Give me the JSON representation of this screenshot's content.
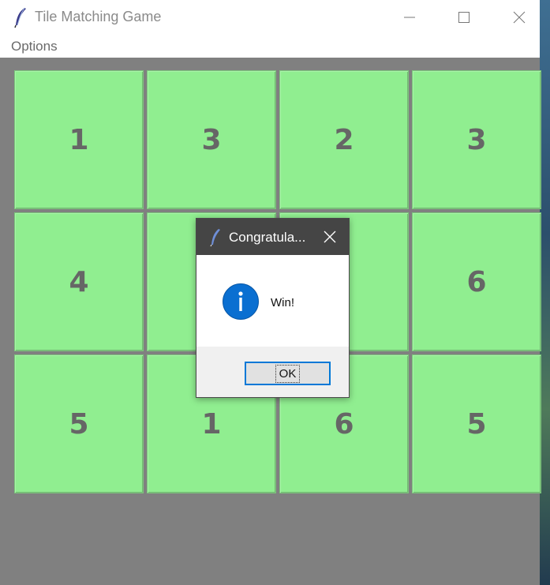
{
  "window": {
    "title": "Tile Matching Game",
    "icon": "feather-icon"
  },
  "menu": {
    "items": [
      {
        "label": "Options"
      }
    ]
  },
  "board": {
    "tile_color": "#90ee90",
    "rows": [
      [
        "1",
        "3",
        "2",
        "3"
      ],
      [
        "4",
        "",
        "",
        "6"
      ],
      [
        "5",
        "1",
        "6",
        "5"
      ]
    ]
  },
  "dialog": {
    "title": "Congratula...",
    "message": "Win!",
    "ok_label": "OK",
    "icon": "info-icon",
    "accent": "#0078d7"
  }
}
